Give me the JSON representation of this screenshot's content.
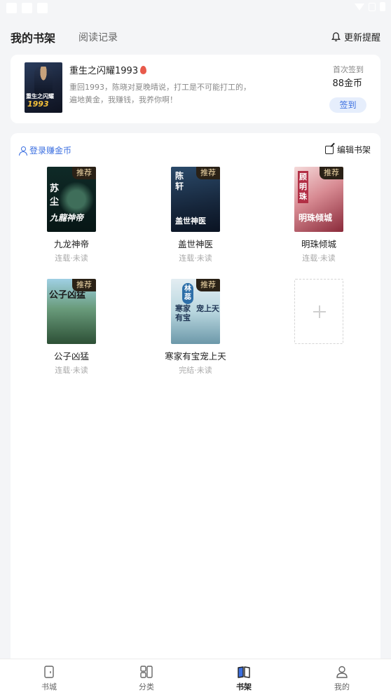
{
  "header": {
    "tab_shelf": "我的书架",
    "tab_history": "阅读记录",
    "update_remind": "更新提醒"
  },
  "featured": {
    "cover_title": "重生之闪耀",
    "cover_year": "1993",
    "title": "重生之闪耀1993",
    "description": "重回1993，陈晓对夏晚晴说，打工是不可能打工的，遍地黄金，我赚钱，我养你啊！",
    "signin_label": "首次签到",
    "signin_coins": "88金币",
    "signin_button": "签到"
  },
  "shelf": {
    "login_coins": "登录赚金币",
    "edit_shelf": "编辑书架",
    "books": [
      {
        "title": "九龙神帝",
        "status": "连载·未读",
        "badge": "推荐",
        "cover_text": "苏尘 九龍神帝"
      },
      {
        "title": "盖世神医",
        "status": "连载·未读",
        "badge": "推荐",
        "cover_text": "陈轩 盖世神医"
      },
      {
        "title": "明珠倾城",
        "status": "连载·未读",
        "badge": "推荐",
        "cover_text": "顾明珠 明珠倾城"
      },
      {
        "title": "公子凶猛",
        "status": "连载·未读",
        "badge": "推荐",
        "cover_text": "公子凶猛"
      },
      {
        "title": "寒家有宝宠上天",
        "status": "完结·未读",
        "badge": "推荐",
        "cover_text": "林蕊 寒家有宝宠上天"
      }
    ]
  },
  "nav": {
    "items": [
      {
        "label": "书城",
        "icon": "bookstore-icon"
      },
      {
        "label": "分类",
        "icon": "category-icon"
      },
      {
        "label": "书架",
        "icon": "bookshelf-icon",
        "active": true
      },
      {
        "label": "我的",
        "icon": "profile-icon"
      }
    ]
  },
  "colors": {
    "accent": "#3b6fe0",
    "badge_bg": "#2a2116",
    "badge_text": "#f1d9a8",
    "page_bg": "#f4f5f7"
  }
}
